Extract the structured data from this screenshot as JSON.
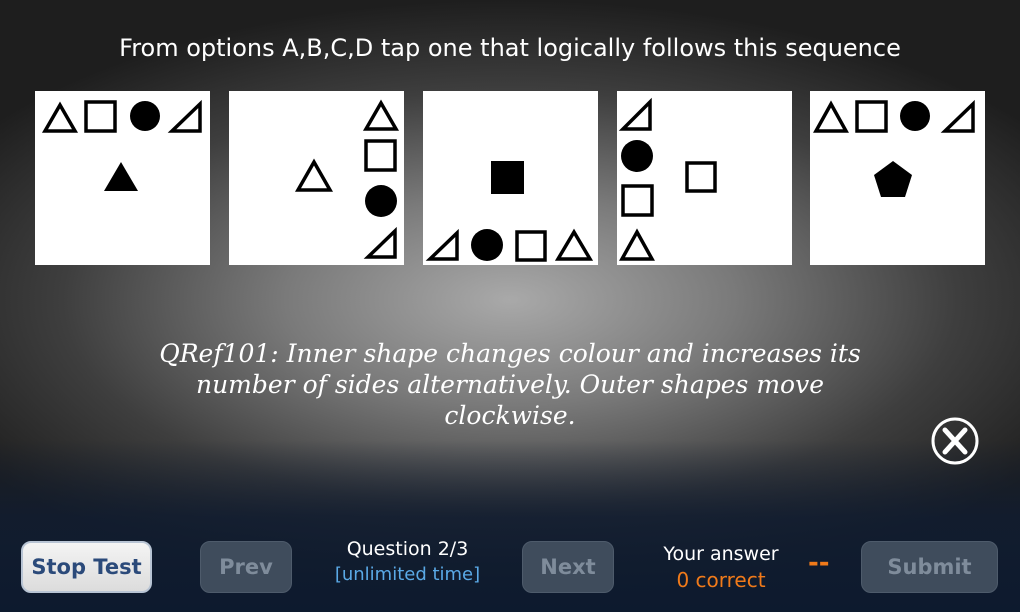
{
  "question": "From options A,B,C,D tap one that logically follows this sequence",
  "explanation": "QRef101: Inner shape changes colour and increases its number of sides alternatively. Outer shapes move clockwise.",
  "buttons": {
    "stop": "Stop Test",
    "prev": "Prev",
    "next": "Next",
    "submit": "Submit"
  },
  "status": {
    "question_counter": "Question 2/3",
    "time_label": "[unlimited time]",
    "answer_label": "Your answer",
    "score": "0 correct",
    "answer_value": "--"
  },
  "icons": {
    "close": "close-circle-icon"
  },
  "colors": {
    "accent_orange": "#f07a1a",
    "time_blue": "#5aa9e6",
    "stop_text": "#2b4a7a"
  }
}
